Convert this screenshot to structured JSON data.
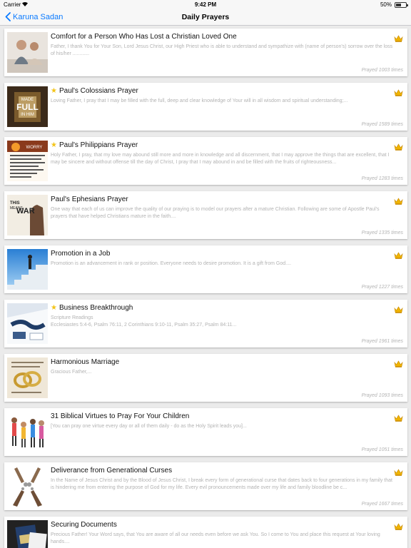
{
  "status_bar": {
    "carrier": "Carrier",
    "time": "9:42 PM",
    "battery": "50%"
  },
  "nav": {
    "back_label": "Karuna Sadan",
    "title": "Daily Prayers"
  },
  "colors": {
    "accent": "#0a7aff",
    "star": "#f3c419",
    "crown": "#f0b400",
    "muted": "#b3b3b3"
  },
  "prayers": [
    {
      "title": "Comfort for a Person Who Has Lost a Christian Loved One",
      "starred": false,
      "desc": "Father, I thank You for Your Son, Lord Jesus Christ, our High Priest who is able to understand and sympathize with (name of person's) sorrow over the loss of his/her ............",
      "count": "Prayed 1003 times"
    },
    {
      "title": "Paul's Colossians Prayer",
      "starred": true,
      "desc": "Loving Father, I pray that I may be filled with the full, deep and clear knowledge of Your will in all wisdom and spiritual understanding;...",
      "count": "Prayed 1589 times"
    },
    {
      "title": "Paul's Philippians Prayer",
      "starred": true,
      "desc": "Holy Father, I pray, that my love may abound still more and more in knowledge and all discernment, that I may approve the things that are excellent, that I may be sincere and without offense till the day of Christ, I pray that I may abound in and be filled with the fruits of righteousness...",
      "count": "Prayed 1283 times"
    },
    {
      "title": "Paul's Ephesians Prayer",
      "starred": false,
      "desc": "One way that each of us can improve the quality of our praying is to model our prayers after a mature Christian. Following are some of Apostle Paul's prayers that have helped Christians mature in the faith....",
      "count": "Prayed 1335 times"
    },
    {
      "title": "Promotion in a Job",
      "starred": false,
      "desc": "Promotion is an advancement in rank or position. Everyone needs to desire promotion. It is a gift from God....",
      "count": "Prayed 1227 times"
    },
    {
      "title": "Business Breakthrough",
      "starred": true,
      "desc": "Scripture Readings\nEcclesiastes 5:4-6, Psalm 76:11, 2 Corinthians 9:10-11,  Psalm 35:27, Psalm 84:11...",
      "count": "Prayed 1961 times"
    },
    {
      "title": "Harmonious Marriage",
      "starred": false,
      "desc": "Gracious Father,...",
      "count": "Prayed 1093 times"
    },
    {
      "title": "31 Biblical Virtues to Pray For Your Children",
      "starred": false,
      "desc": "[You can pray one virtue every day or all of them daily - do as the Holy Spirit leads you]...",
      "count": "Prayed 1051 times"
    },
    {
      "title": "Deliverance from Generational Curses",
      "starred": false,
      "desc": "In the Name of Jesus Christ and by the Blood of Jesus Christ, I break every form of generational curse that dates back to four generations in my family that is hindering me from entering the purpose of God for my life. Every evil pronouncements made over my life and family bloodline be c...",
      "count": "Prayed 1667 times"
    },
    {
      "title": "Securing Documents",
      "starred": false,
      "desc": "Precious Father! Your Word says, that You are aware of all our needs even before we ask You. So I come to You and place this request at Your loving hands....",
      "count": ""
    }
  ],
  "thumbnails": [
    {
      "text": ""
    },
    {
      "text": "MADE FULL IN HIM"
    },
    {
      "text": "WORRY"
    },
    {
      "text": "THIS MEANS WAR"
    },
    {
      "text": ""
    },
    {
      "text": ""
    },
    {
      "text": ""
    },
    {
      "text": ""
    },
    {
      "text": ""
    },
    {
      "text": ""
    }
  ]
}
